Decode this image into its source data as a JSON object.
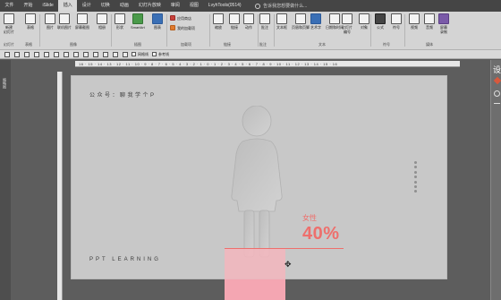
{
  "menu": {
    "items": [
      "文件",
      "开始",
      "iSlide",
      "插入",
      "设计",
      "切换",
      "动画",
      "幻灯片放映",
      "审阅",
      "视图",
      "LvyhTools(0514)"
    ],
    "active_index": 3,
    "search_placeholder": "告诉我您想要做什么..."
  },
  "ribbon": {
    "buttons": [
      {
        "label": "新建\n幻灯片",
        "icon": "new-slide-icon"
      },
      {
        "label": "表格",
        "icon": "table-icon"
      },
      {
        "label": "图片",
        "icon": "picture-icon"
      },
      {
        "label": "联机图片",
        "icon": "online-picture-icon"
      },
      {
        "label": "屏幕截图",
        "icon": "screenshot-icon"
      },
      {
        "label": "相册",
        "icon": "album-icon"
      },
      {
        "label": "形状",
        "icon": "shapes-icon"
      },
      {
        "label": "SmartArt",
        "icon": "smartart-icon"
      },
      {
        "label": "图表",
        "icon": "chart-icon"
      },
      {
        "label": "应用商店",
        "icon": "store-icon"
      },
      {
        "label": "我的加载项",
        "icon": "addins-icon"
      },
      {
        "label": "缩放",
        "icon": "zoom-icon"
      },
      {
        "label": "链接",
        "icon": "link-icon"
      },
      {
        "label": "动作",
        "icon": "action-icon"
      },
      {
        "label": "批注",
        "icon": "comment-icon"
      },
      {
        "label": "文本框",
        "icon": "textbox-icon"
      },
      {
        "label": "页眉和页脚",
        "icon": "header-footer-icon"
      },
      {
        "label": "艺术字",
        "icon": "wordart-icon"
      },
      {
        "label": "日期和时间",
        "icon": "datetime-icon"
      },
      {
        "label": "幻灯片\n编号",
        "icon": "slide-number-icon"
      },
      {
        "label": "对象",
        "icon": "object-icon"
      },
      {
        "label": "公式",
        "icon": "equation-icon"
      },
      {
        "label": "符号",
        "icon": "symbol-icon"
      },
      {
        "label": "视频",
        "icon": "video-icon"
      },
      {
        "label": "音频",
        "icon": "audio-icon"
      },
      {
        "label": "屏幕\n录制",
        "icon": "screen-record-icon"
      }
    ],
    "groups": [
      "幻灯片",
      "表格",
      "图像",
      "插图",
      "加载项",
      "链接",
      "批注",
      "文本",
      "符号",
      "媒体"
    ]
  },
  "quickbar": {
    "checkboxes": [
      "网格线",
      "参考线"
    ]
  },
  "left_pane": {
    "label": "缩略图"
  },
  "ruler": {
    "numbers": "16 · 15 · 14 · 13 · 12 · 11 · 10 · 9 · 8 · 7 · 6 · 5 · 4 · 3 · 2 · 1 · 0 · 1 · 2 · 3 · 4 · 5 · 6 · 7 · 8 · 9 · 10 · 11 · 12 · 13 · 14 · 15 · 16"
  },
  "slide": {
    "public_line": "公众号：聊我学个P",
    "english": "PPT LEARNING",
    "label": "女性",
    "value": "40%",
    "accent_color": "#ee6f6c",
    "dot_count": 7
  },
  "right_pane": {
    "label": "设"
  }
}
